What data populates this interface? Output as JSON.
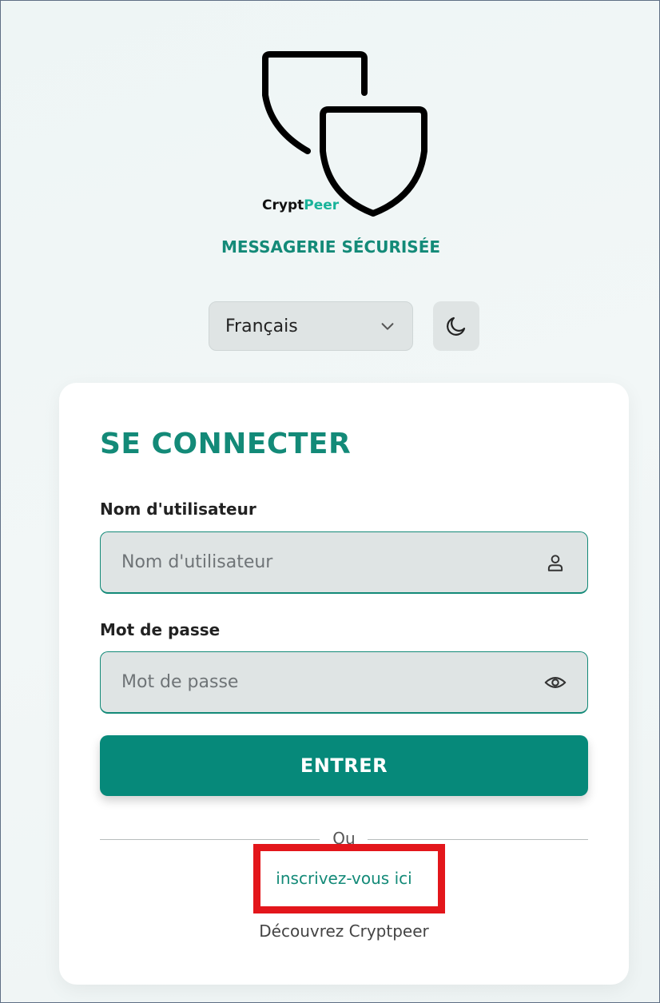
{
  "brand": {
    "name_part1": "Crypt",
    "name_part2": "Peer",
    "tagline": "MESSAGERIE SÉCURISÉE",
    "logo_icon": "double-shield-icon"
  },
  "controls": {
    "language": {
      "selected": "Français",
      "icon": "chevron-down-icon"
    },
    "theme_toggle": {
      "icon": "moon-icon"
    }
  },
  "login": {
    "title": "SE CONNECTER",
    "username": {
      "label": "Nom d'utilisateur",
      "placeholder": "Nom d'utilisateur",
      "value": "",
      "icon": "user-icon"
    },
    "password": {
      "label": "Mot de passe",
      "placeholder": "Mot de passe",
      "value": "",
      "icon": "eye-icon"
    },
    "submit_label": "ENTRER",
    "divider_text": "Ou",
    "signup_link": "inscrivez-vous ici",
    "discover_text": "Découvrez Cryptpeer"
  },
  "colors": {
    "accent": "#138a78",
    "button": "#06897a",
    "highlight": "#e3161b"
  }
}
